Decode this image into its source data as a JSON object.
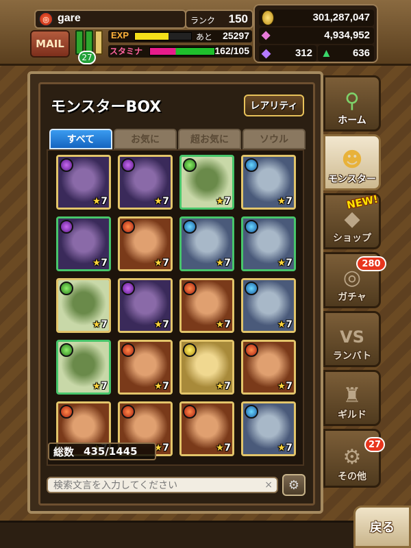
{
  "player": {
    "name": "gare",
    "rank_label": "ランク",
    "rank": "150"
  },
  "mail_label": "MAIL",
  "books_count": "27",
  "exp": {
    "label": "EXP",
    "next_label": "あと",
    "remaining": "25297",
    "fill_fraction": 0.6
  },
  "stamina": {
    "label": "スタミナ",
    "value": "162/105",
    "fill_fraction": 1.0
  },
  "currency": {
    "gold": "301,287,047",
    "crystal": "4,934,952",
    "gem": "312",
    "green": "636"
  },
  "box": {
    "title": "モンスターBOX",
    "rarity_button": "レアリティ",
    "tabs": [
      {
        "label": "すべて",
        "active": true
      },
      {
        "label": "お気に",
        "active": false
      },
      {
        "label": "超お気に",
        "active": false
      },
      {
        "label": "ソウル",
        "active": false
      }
    ],
    "count_label": "総数",
    "count_value": "435/1445",
    "search_placeholder": "検索文言を入力してください",
    "clear_symbol": "×"
  },
  "monsters": [
    {
      "element": "dark",
      "star": "★",
      "level": "7",
      "frame": "gold"
    },
    {
      "element": "dark",
      "star": "★",
      "level": "7",
      "frame": "gold"
    },
    {
      "element": "wood",
      "star": "★",
      "level": "7",
      "frame": "green"
    },
    {
      "element": "water",
      "star": "★",
      "level": "7",
      "frame": "gold"
    },
    {
      "element": "dark",
      "star": "★",
      "level": "7",
      "frame": "green"
    },
    {
      "element": "fire",
      "star": "★",
      "level": "7",
      "frame": "gold"
    },
    {
      "element": "water",
      "star": "★",
      "level": "7",
      "frame": "green"
    },
    {
      "element": "water",
      "star": "★",
      "level": "7",
      "frame": "green"
    },
    {
      "element": "wood",
      "star": "★",
      "level": "7",
      "frame": "gold"
    },
    {
      "element": "dark",
      "star": "★",
      "level": "7",
      "frame": "gold"
    },
    {
      "element": "fire",
      "star": "★",
      "level": "7",
      "frame": "gold"
    },
    {
      "element": "water",
      "star": "★",
      "level": "7",
      "frame": "gold"
    },
    {
      "element": "wood",
      "star": "★",
      "level": "7",
      "frame": "green"
    },
    {
      "element": "fire",
      "star": "★",
      "level": "7",
      "frame": "gold"
    },
    {
      "element": "light",
      "star": "★",
      "level": "7",
      "frame": "gold"
    },
    {
      "element": "fire",
      "star": "★",
      "level": "7",
      "frame": "gold"
    },
    {
      "element": "fire",
      "star": "★",
      "level": "7",
      "frame": "gold"
    },
    {
      "element": "fire",
      "star": "★",
      "level": "7",
      "frame": "gold"
    },
    {
      "element": "fire",
      "star": "★",
      "level": "7",
      "frame": "gold"
    },
    {
      "element": "water",
      "star": "★",
      "level": "7",
      "frame": "gold"
    }
  ],
  "side_menu": [
    {
      "label": "ホーム",
      "icon": "map-pin-icon"
    },
    {
      "label": "モンスター",
      "icon": "dragon-icon",
      "active": true
    },
    {
      "label": "ショップ",
      "icon": "crystal-icon",
      "tag": "NEW!"
    },
    {
      "label": "ガチャ",
      "icon": "gacha-icon",
      "badge": "280"
    },
    {
      "label": "ランバト",
      "icon": "vs-icon"
    },
    {
      "label": "ギルド",
      "icon": "castle-icon"
    },
    {
      "label": "その他",
      "icon": "gear-icon",
      "badge": "27"
    }
  ],
  "back_label": "戻る",
  "colors": {
    "accent_blue": "#1f7fe0",
    "frame_gold": "#e3c56a",
    "frame_green": "#47c66b",
    "badge_red": "#e8361e"
  }
}
